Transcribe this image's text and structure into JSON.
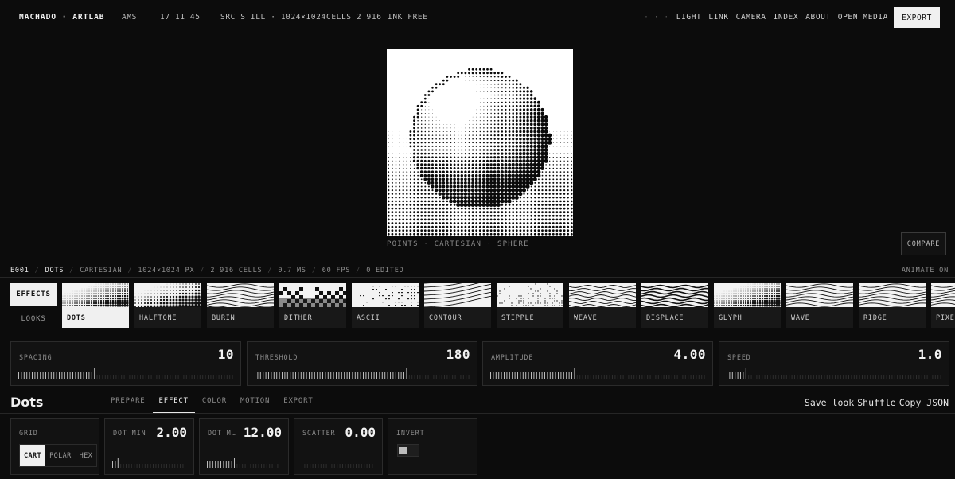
{
  "topbar": {
    "brand": "MACHADO · ARTLAB",
    "city": "AMS",
    "time": "17 11 45",
    "src": "SRC STILL · 1024×1024",
    "cells": "CELLS 2 916",
    "ink": "INK FREE",
    "nav_dim": "· · ·",
    "nav": [
      "LIGHT",
      "LINK",
      "CAMERA",
      "INDEX",
      "ABOUT",
      "OPEN MEDIA"
    ],
    "export_label": "EXPORT"
  },
  "preview": {
    "caption": "POINTS · CARTESIAN · SPHERE",
    "compare_label": "COMPARE"
  },
  "status": {
    "items": [
      "E001",
      "DOTS",
      "CARTESIAN",
      "1024×1024 PX",
      "2 916 CELLS",
      "0.7 MS",
      "60 FPS",
      "0 EDITED"
    ],
    "right": "ANIMATE ON"
  },
  "side": {
    "effects_label": "EFFECTS",
    "looks_label": "LOOKS"
  },
  "effects": [
    "DOTS",
    "HALFTONE",
    "BURIN",
    "DITHER",
    "ASCII",
    "CONTOUR",
    "STIPPLE",
    "WEAVE",
    "DISPLACE",
    "GLYPH",
    "WAVE",
    "RIDGE",
    "PIXEL"
  ],
  "params": [
    {
      "label": "SPACING",
      "value": "10",
      "level": 0.36
    },
    {
      "label": "THRESHOLD",
      "value": "180",
      "level": 0.71
    },
    {
      "label": "AMPLITUDE",
      "value": "4.00",
      "level": 0.4
    },
    {
      "label": "SPEED",
      "value": "1.0",
      "level": 0.1
    }
  ],
  "section": {
    "title": "Dots",
    "tabs": [
      "PREPARE",
      "EFFECT",
      "COLOR",
      "MOTION",
      "EXPORT"
    ],
    "active_tab": "EFFECT",
    "actions": [
      "Save look",
      "Shuffle",
      "Copy JSON"
    ]
  },
  "cards": {
    "grid_label": "GRID",
    "grid_options": [
      "CART",
      "POLAR",
      "HEX"
    ],
    "grid_selected": "CART",
    "dot_min_label": "DOT MIN",
    "dot_min_value": "2.00",
    "dot_max_label": "DOT M…",
    "dot_max_value": "12.00",
    "scatter_label": "SCATTER",
    "scatter_value": "0.00",
    "invert_label": "INVERT"
  },
  "colors": {
    "background": "#0c0c0c",
    "panel": "#121212",
    "accent": "#f0f0f0"
  }
}
